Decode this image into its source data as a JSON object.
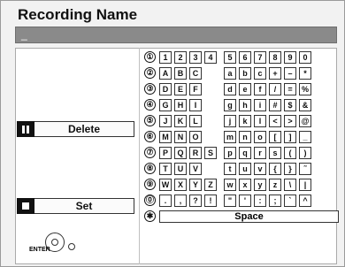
{
  "title": "Recording Name",
  "input_value": "_",
  "delete_label": "Delete",
  "set_label": "Set",
  "enter_label": "ENTER",
  "space_label": "Space",
  "row_numbers": [
    "①",
    "②",
    "③",
    "④",
    "⑤",
    "⑥",
    "⑦",
    "⑧",
    "⑨",
    "⓪"
  ],
  "rows": [
    [
      "1",
      "2",
      "3",
      "4",
      "5",
      "6",
      "7",
      "8",
      "9",
      "0"
    ],
    [
      "A",
      "B",
      "C",
      "",
      "a",
      "b",
      "c",
      "+",
      "–",
      "*"
    ],
    [
      "D",
      "E",
      "F",
      "",
      "d",
      "e",
      "f",
      "/",
      "=",
      "%"
    ],
    [
      "G",
      "H",
      "I",
      "",
      "g",
      "h",
      "i",
      "#",
      "$",
      "&"
    ],
    [
      "J",
      "K",
      "L",
      "",
      "j",
      "k",
      "l",
      "<",
      ">",
      "@"
    ],
    [
      "M",
      "N",
      "O",
      "",
      "m",
      "n",
      "o",
      "[",
      "]",
      "_"
    ],
    [
      "P",
      "Q",
      "R",
      "S",
      "p",
      "q",
      "r",
      "s",
      "(",
      ")"
    ],
    [
      "T",
      "U",
      "V",
      "",
      "t",
      "u",
      "v",
      "{",
      "}",
      "˜"
    ],
    [
      "W",
      "X",
      "Y",
      "Z",
      "w",
      "x",
      "y",
      "z",
      "\\",
      "|"
    ],
    [
      ".",
      ",",
      "?",
      "!",
      "\"",
      "'",
      ":",
      ";",
      "`",
      "^"
    ]
  ],
  "space_key": "✱",
  "icons": {
    "delete": "pause-icon",
    "set": "stop-icon",
    "enter": "enter-dpad-icon",
    "return": "return-icon"
  }
}
